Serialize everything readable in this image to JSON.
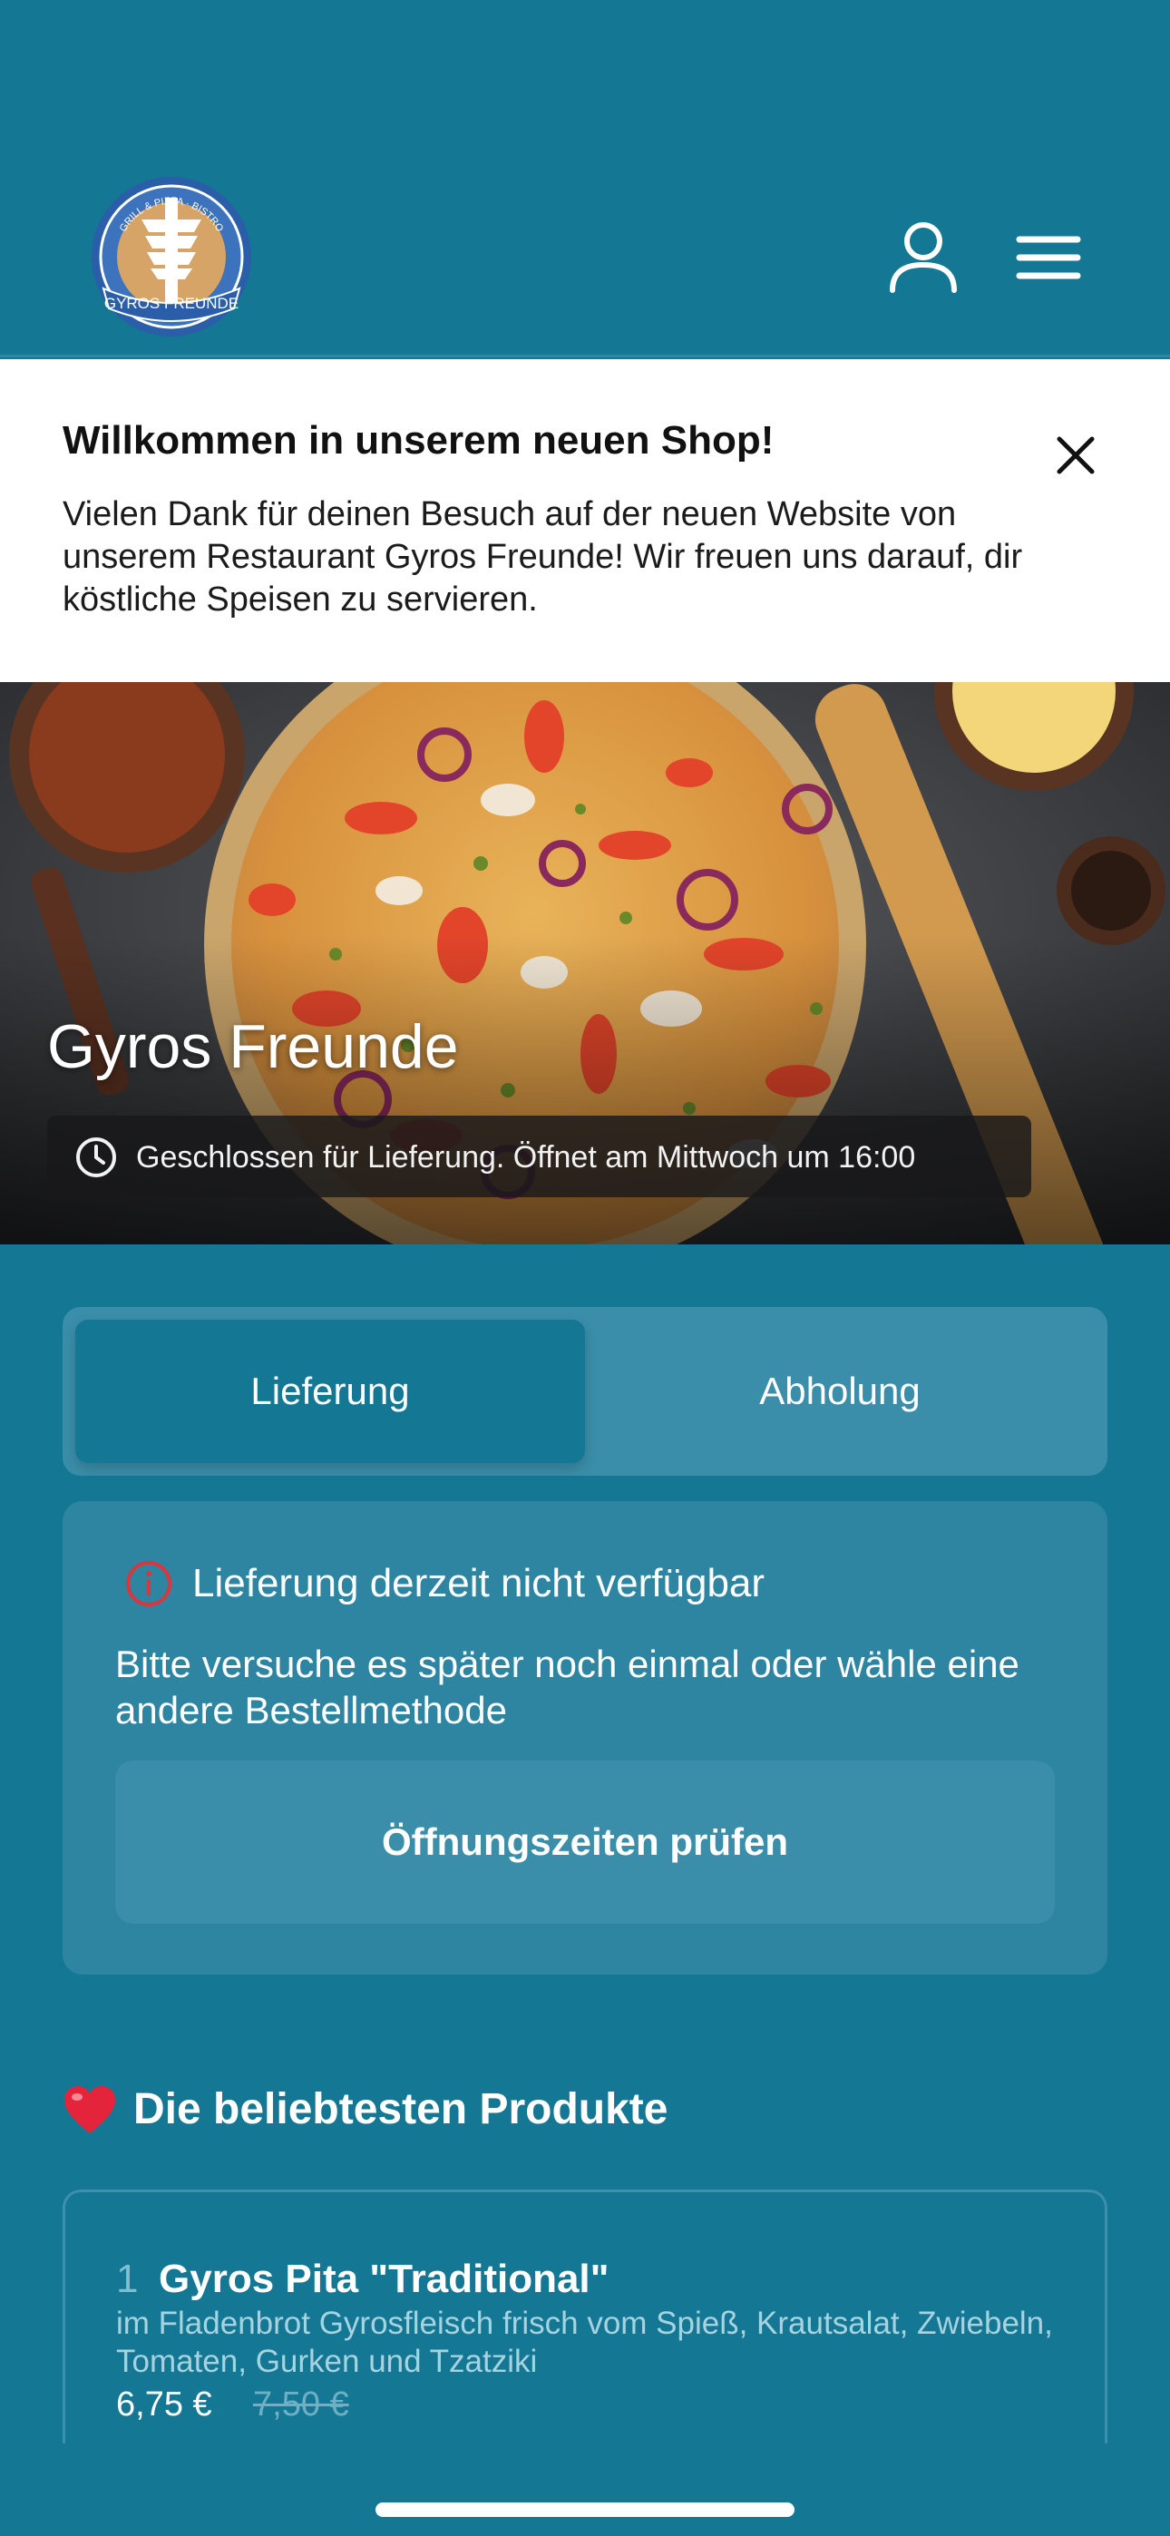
{
  "header": {
    "logo": {
      "arc_text": "GRILL & PIZZA · BISTRO",
      "name": "GYROS FREUNDE"
    },
    "icons": {
      "account": "user-icon",
      "menu": "hamburger-menu-icon"
    }
  },
  "announcement": {
    "title": "Willkommen in unserem neuen Shop!",
    "text": "Vielen Dank für deinen Besuch auf der neuen Website von unserem Restaurant Gyros Freunde! Wir freuen uns darauf, dir köstliche Speisen zu servieren.",
    "close_icon": "close-icon"
  },
  "hero": {
    "restaurant_name": "Gyros Freunde",
    "status": "Geschlossen für Lieferung. Öffnet am Mittwoch um 16:00"
  },
  "order_mode": {
    "tabs": [
      "Lieferung",
      "Abholung"
    ],
    "selected": "Lieferung"
  },
  "notice": {
    "title": "Lieferung derzeit nicht verfügbar",
    "text": "Bitte versuche es später noch einmal oder wähle eine andere Bestellmethode",
    "button": "Öffnungszeiten prüfen"
  },
  "popular": {
    "title": "Die beliebtesten Produkte",
    "products": [
      {
        "rank": "1",
        "name": "Gyros Pita \"Traditional\"",
        "description": "im Fladenbrot Gyrosfleisch frisch vom Spieß, Krautsalat, Zwiebeln, Tomaten, Gurken und Tzatziki",
        "price": "6,75 €",
        "old_price": "7,50 €"
      }
    ]
  },
  "colors": {
    "brand": "#147794",
    "card": "#2d85a1",
    "toggle_bg": "#3a8ea9",
    "alert": "#d9363e"
  }
}
